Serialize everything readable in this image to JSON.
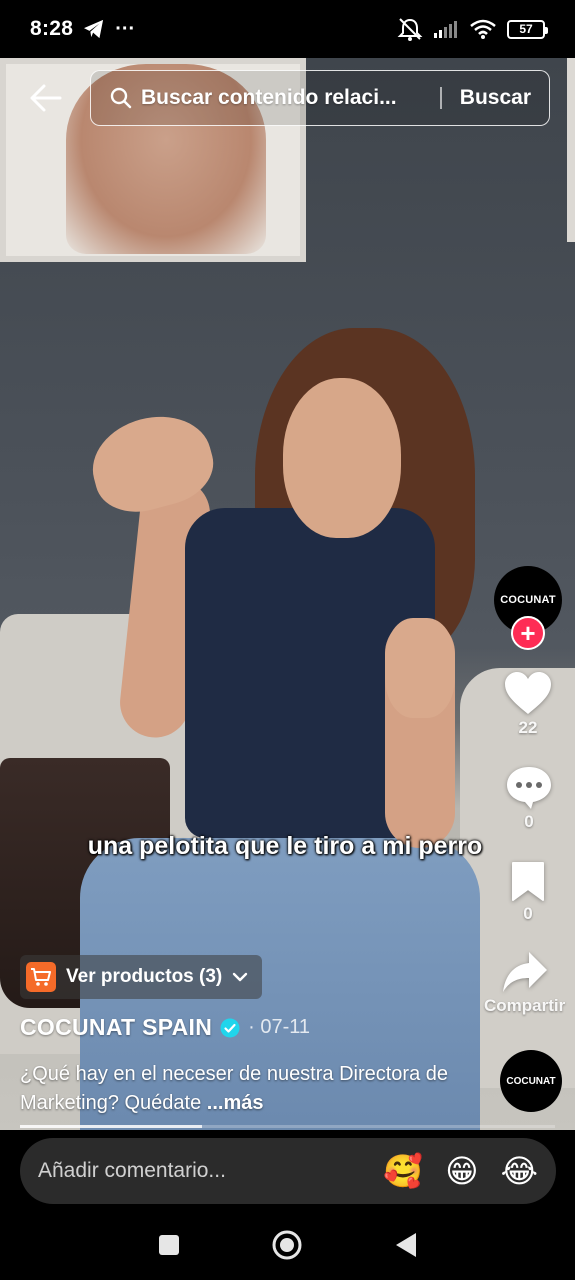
{
  "status_bar": {
    "time": "8:28",
    "dots": "···",
    "battery": "57"
  },
  "search": {
    "placeholder": "Buscar contenido relaci...",
    "submit_label": "Buscar"
  },
  "creator": {
    "avatar_text": "COCUNAT",
    "follow_symbol": "+"
  },
  "actions": {
    "likes": "22",
    "comments": "0",
    "saves": "0",
    "share_label": "Compartir"
  },
  "video": {
    "subtitle": "una pelotita que le tiro a mi perro",
    "progress": 0.34
  },
  "products": {
    "label": "Ver productos (3)"
  },
  "post": {
    "author": "COCUNAT SPAIN",
    "date": "· 07-11",
    "description": "¿Qué hay en el neceser de nuestra Directora de Marketing? Quédate ",
    "more": "...más"
  },
  "sound": {
    "disc_text": "COCUNAT"
  },
  "comment_bar": {
    "placeholder": "Añadir comentario...",
    "emojis": [
      "🥰",
      "😁",
      "😂"
    ]
  },
  "colors": {
    "accent": "#fe2c55",
    "cart": "#f56b29",
    "verified": "#20d5ec"
  },
  "icons": [
    "back-arrow-icon",
    "search-icon",
    "heart-icon",
    "comment-icon",
    "bookmark-icon",
    "share-icon",
    "cart-icon",
    "chevron-down-icon",
    "verified-icon",
    "square-icon",
    "circle-icon",
    "triangle-back-icon"
  ]
}
